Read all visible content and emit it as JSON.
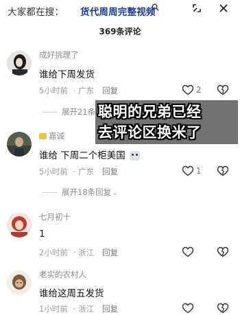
{
  "search": {
    "prefix": "大家都在搜：",
    "term": "货代周周完整视频"
  },
  "comments_header": {
    "count_title": "369条评论"
  },
  "overlay": {
    "line1": "聪明的兄弟已经",
    "line2": "去评论区换米了"
  },
  "comments": [
    {
      "username": "成好挑理了",
      "text": "谁给下周发货",
      "time": "5小时前",
      "location": "广东",
      "reply_label": "回复",
      "likes": "2",
      "expand_label": "展开21条回复"
    },
    {
      "username": "嘉诚",
      "text": "谁给 下周二个柜美国",
      "time": "5小时前",
      "location": "广东",
      "reply_label": "回复",
      "likes": "1",
      "expand_label": "展开18条回复"
    },
    {
      "username": "七月初十",
      "text": "1",
      "time": "2小时前",
      "location": "浙江",
      "reply_label": "回复",
      "likes": ""
    },
    {
      "username": "老实的农村人",
      "text": "谁给这周五发货",
      "time": "1小时前",
      "location": "浙江",
      "reply_label": "回复",
      "likes": ""
    }
  ]
}
